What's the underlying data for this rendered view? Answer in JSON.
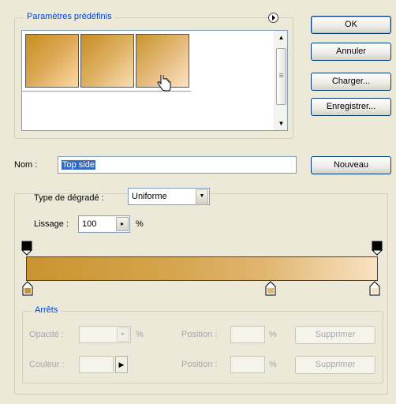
{
  "presets": {
    "title": "Paramètres prédéfinis",
    "menu_icon": "circle-arrow-icon",
    "swatches": [
      {
        "name": "gradient-1",
        "from": "#c8901f",
        "to": "#fcd9a6"
      },
      {
        "name": "gradient-2",
        "from": "#c88d26",
        "to": "#f8ddb4"
      },
      {
        "name": "gradient-3",
        "from": "#c9952c",
        "to": "#fde2c4"
      }
    ]
  },
  "buttons": {
    "ok": "OK",
    "cancel": "Annuler",
    "load": "Charger...",
    "save": "Enregistrer...",
    "new": "Nouveau"
  },
  "name": {
    "label": "Nom :",
    "value": "Top side"
  },
  "gradient": {
    "type_label": "Type de dégradé :",
    "type_value": "Uniforme",
    "smoothness_label": "Lissage :",
    "smoothness_value": "100",
    "smoothness_unit": "%",
    "bar_colors": [
      "#c9932f",
      "#e0b570",
      "#f9e2c3"
    ]
  },
  "stops": {
    "title": "Arrêts",
    "opacity_label": "Opacité :",
    "opacity_unit": "%",
    "position_label": "Position :",
    "position_unit": "%",
    "delete_label": "Supprimer",
    "color_label": "Couleur :",
    "position2_label": "Position :",
    "position2_unit": "%",
    "delete2_label": "Supprimer"
  }
}
